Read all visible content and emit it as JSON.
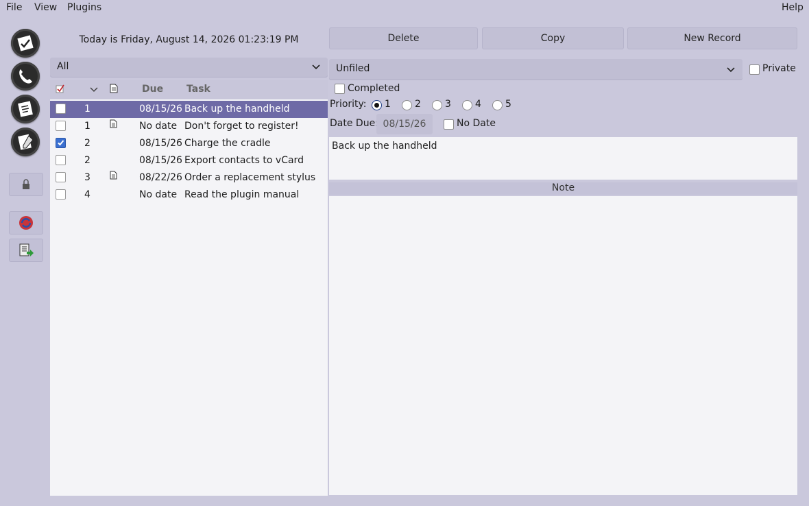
{
  "menu": {
    "file": "File",
    "view": "View",
    "plugins": "Plugins",
    "help": "Help"
  },
  "launcher": [
    {
      "name": "datebook-app",
      "icon": "calendar-icon"
    },
    {
      "name": "address-app",
      "icon": "phone-icon"
    },
    {
      "name": "todo-app",
      "icon": "checklist-icon"
    },
    {
      "name": "memo-app",
      "icon": "memo-icon"
    }
  ],
  "sidebar_buttons": [
    {
      "name": "lock-button",
      "icon": "lock-icon"
    },
    {
      "name": "sync-button",
      "icon": "sync-icon"
    },
    {
      "name": "backup-button",
      "icon": "backup-icon"
    }
  ],
  "today_label": "Today is Friday, August 14, 2026 01:23:19 PM",
  "category_filter": "All",
  "list_header": {
    "due": "Due",
    "task": "Task"
  },
  "todos": [
    {
      "completed": false,
      "priority": "1",
      "note": false,
      "due": "08/15/26",
      "task": "Back up the handheld",
      "selected": true
    },
    {
      "completed": false,
      "priority": "1",
      "note": true,
      "due": "No date",
      "task": "Don't forget to register!",
      "selected": false
    },
    {
      "completed": true,
      "priority": "2",
      "note": false,
      "due": "08/15/26",
      "task": "Charge the cradle",
      "selected": false
    },
    {
      "completed": false,
      "priority": "2",
      "note": false,
      "due": "08/15/26",
      "task": "Export contacts to vCard",
      "selected": false
    },
    {
      "completed": false,
      "priority": "3",
      "note": true,
      "due": "08/22/26",
      "task": "Order a replacement stylus",
      "selected": false
    },
    {
      "completed": false,
      "priority": "4",
      "note": false,
      "due": "No date",
      "task": "Read the plugin manual",
      "selected": false
    }
  ],
  "toolbar": {
    "delete": "Delete",
    "copy": "Copy",
    "new_record": "New Record"
  },
  "detail": {
    "category": "Unfiled",
    "private_label": "Private",
    "private_checked": false,
    "completed_label": "Completed",
    "completed_checked": false,
    "priority_label": "Priority:",
    "priorities": [
      "1",
      "2",
      "3",
      "4",
      "5"
    ],
    "priority_selected": "1",
    "date_due_label": "Date Due:",
    "date_due_value": "08/15/26",
    "no_date_label": "No Date",
    "no_date_checked": false,
    "description": "Back up the handheld",
    "note_header": "Note",
    "note": ""
  },
  "colors": {
    "background": "#cac8dc",
    "selection": "#6e6aa6",
    "field": "#f4f4f7",
    "checkbox_checked": "#3a6fd0"
  }
}
